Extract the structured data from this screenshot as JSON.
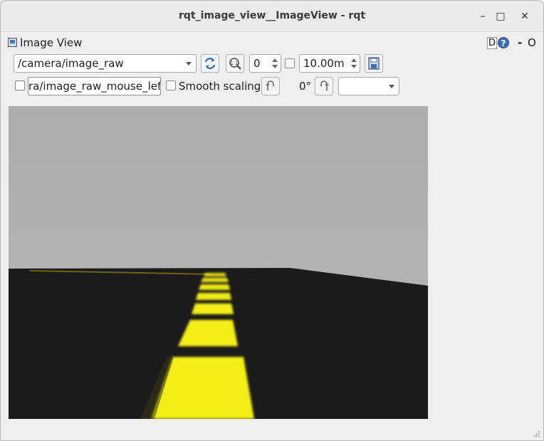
{
  "window": {
    "title": "rqt_image_view__ImageView - rqt",
    "minimize": "–",
    "maximize": "□",
    "close": "✕"
  },
  "plugin": {
    "title": "Image View",
    "d_label": "D",
    "help_label": "?",
    "dash_label": "-",
    "close_label": "O"
  },
  "toolbar": {
    "topic": "/camera/image_raw",
    "refresh_icon": "refresh-icon",
    "zoom_icon": "zoom-fit-icon",
    "zoom_value": "0",
    "dynamic_range_checked": false,
    "max_range_value": "10.00m",
    "save_icon": "save-icon"
  },
  "toolbar2": {
    "mouse_checked": false,
    "mouse_topic": "ra/image_raw_mouse_left",
    "smooth_checked": false,
    "smooth_label": "Smooth scaling",
    "rotate_left_icon": "rotate-left-icon",
    "rotation_value": "0°",
    "rotate_right_icon": "rotate-right-icon",
    "color_scheme_value": ""
  },
  "image": {
    "description_colors": {
      "sky": "#b3b3b3",
      "road": "#1b1b1b",
      "lane": "#f4ee12"
    }
  }
}
